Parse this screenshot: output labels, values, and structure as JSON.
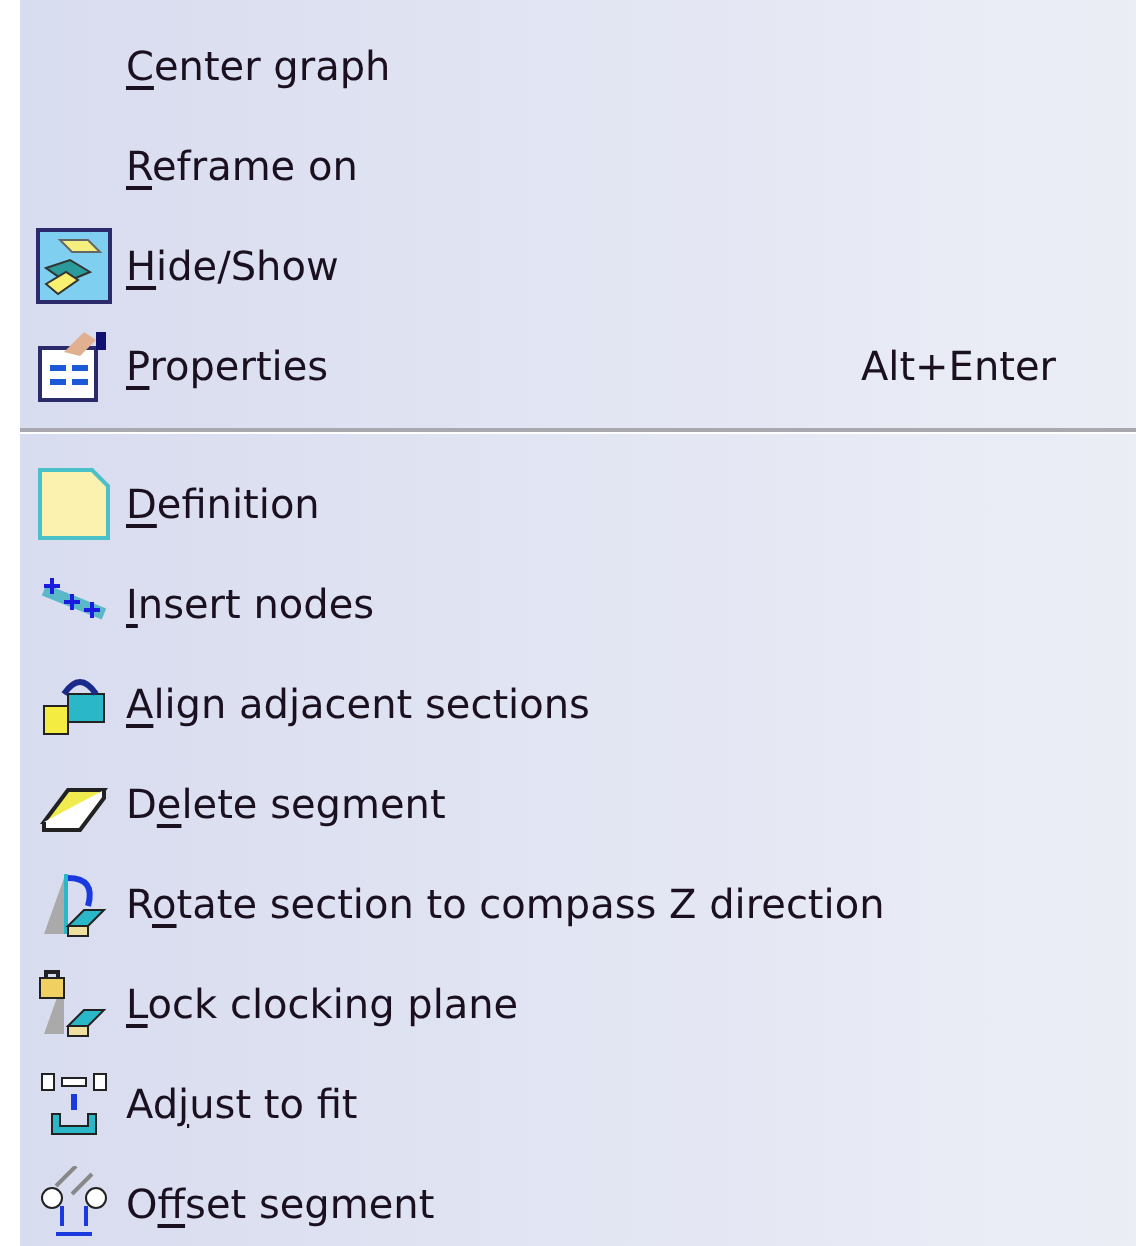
{
  "menu": {
    "sections": [
      {
        "items": [
          {
            "kind": "text",
            "key": "C",
            "post": "enter graph"
          },
          {
            "kind": "text",
            "key": "R",
            "post": "eframe on"
          },
          {
            "kind": "icon",
            "key": "H",
            "post": "ide/Show"
          },
          {
            "kind": "icon",
            "key": "P",
            "post": "roperties",
            "shortcut": "Alt+Enter"
          }
        ]
      },
      {
        "items": [
          {
            "kind": "icon",
            "key": "D",
            "post": "efinition"
          },
          {
            "kind": "icon",
            "key": "I",
            "post": "nsert nodes"
          },
          {
            "kind": "icon",
            "key": "A",
            "post": "lign adjacent sections"
          },
          {
            "kind": "icon",
            "pre": "D",
            "key": "e",
            "post": "lete segment"
          },
          {
            "kind": "icon",
            "pre": "R",
            "key": "o",
            "post": "tate section to compass Z direction"
          },
          {
            "kind": "icon",
            "key": "L",
            "post": "ock clocking plane"
          },
          {
            "kind": "icon",
            "pre": "Ad",
            "key": "j",
            "post": "ust to fit"
          },
          {
            "kind": "icon",
            "pre": "O",
            "key": "f",
            "post": "fset segment"
          }
        ]
      }
    ]
  }
}
